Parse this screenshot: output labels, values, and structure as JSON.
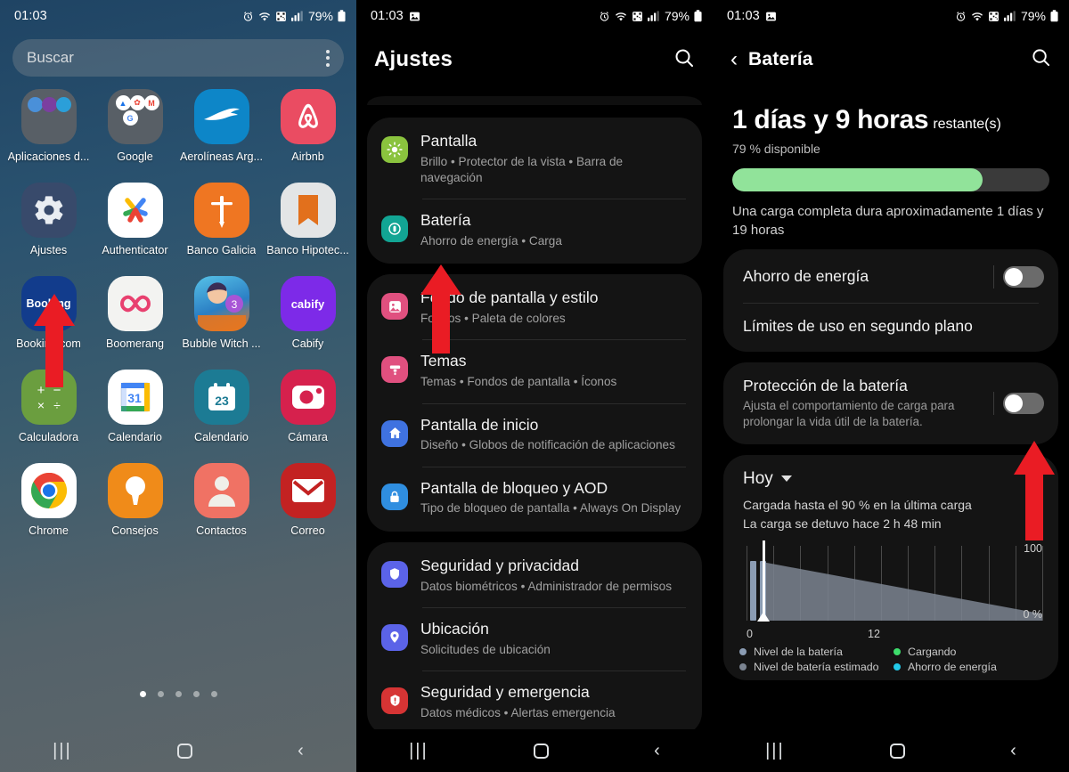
{
  "status_bar": {
    "time": "01:03",
    "battery_pct": "79%",
    "icons": [
      "alarm-icon",
      "wifi-icon",
      "nfc-icon",
      "signal-icon",
      "battery-icon"
    ],
    "icons_left_dark": [
      "screenshot-icon"
    ]
  },
  "home": {
    "search": {
      "placeholder": "Buscar",
      "menu": "more-options"
    },
    "apps": [
      {
        "label": "Aplicaciones d...",
        "type": "folder"
      },
      {
        "label": "Google",
        "type": "folder"
      },
      {
        "label": "Aerolíneas Arg...",
        "type": "app"
      },
      {
        "label": "Airbnb",
        "type": "app"
      },
      {
        "label": "Ajustes",
        "type": "app"
      },
      {
        "label": "Authenticator",
        "type": "app"
      },
      {
        "label": "Banco Galicia",
        "type": "app"
      },
      {
        "label": "Banco Hipotec...",
        "type": "app"
      },
      {
        "label": "Booking.com",
        "type": "app"
      },
      {
        "label": "Boomerang",
        "type": "app"
      },
      {
        "label": "Bubble Witch ...",
        "type": "app"
      },
      {
        "label": "Cabify",
        "type": "app"
      },
      {
        "label": "Calculadora",
        "type": "app"
      },
      {
        "label": "Calendario",
        "type": "app"
      },
      {
        "label": "Calendario",
        "type": "app"
      },
      {
        "label": "Cámara",
        "type": "app"
      },
      {
        "label": "Chrome",
        "type": "app"
      },
      {
        "label": "Consejos",
        "type": "app"
      },
      {
        "label": "Contactos",
        "type": "app"
      },
      {
        "label": "Correo",
        "type": "app"
      }
    ],
    "page_dots": 5,
    "active_dot": 1
  },
  "settings": {
    "title": "Ajustes",
    "search_icon": "search-icon",
    "groups": [
      {
        "items": [
          {
            "title": "Pantalla",
            "subtitle": "Brillo  •  Protector de la vista  •  Barra de navegación",
            "icon": "display-icon",
            "color": "#8ac33e"
          },
          {
            "title": "Batería",
            "subtitle": "Ahorro de energía  •  Carga",
            "icon": "battery-icon",
            "color": "#12a594"
          }
        ]
      },
      {
        "items": [
          {
            "title": "Fondo de pantalla y estilo",
            "subtitle": "Fondos  •  Paleta de colores",
            "icon": "wallpaper-icon",
            "color": "#e0507f"
          },
          {
            "title": "Temas",
            "subtitle": "Temas  •  Fondos de pantalla  •  Íconos",
            "icon": "themes-icon",
            "color": "#e0507f"
          },
          {
            "title": "Pantalla de inicio",
            "subtitle": "Diseño  •  Globos de notificación de aplicaciones",
            "icon": "home-icon",
            "color": "#3f72e0"
          },
          {
            "title": "Pantalla de bloqueo y AOD",
            "subtitle": "Tipo de bloqueo de pantalla  •  Always On Display",
            "icon": "lock-icon",
            "color": "#2f8ee0"
          }
        ]
      },
      {
        "items": [
          {
            "title": "Seguridad y privacidad",
            "subtitle": "Datos biométricos  •  Administrador de permisos",
            "icon": "shield-icon",
            "color": "#5b63e8"
          },
          {
            "title": "Ubicación",
            "subtitle": "Solicitudes de ubicación",
            "icon": "location-pin-icon",
            "color": "#5b63e8"
          },
          {
            "title": "Seguridad y emergencia",
            "subtitle": "Datos médicos  •  Alertas emergencia",
            "icon": "emergency-icon",
            "color": "#d63434"
          }
        ]
      }
    ]
  },
  "battery": {
    "title": "Batería",
    "back_icon": "back-arrow-icon",
    "search_icon": "search-icon",
    "remaining_headline": "1 días y 9 horas",
    "remaining_suffix": "restante(s)",
    "available": "79 % disponible",
    "level_pct": 79,
    "bar_color": "#91e39a",
    "full_charge_note": "Una carga completa dura aproximadamente 1 días y 19 horas",
    "power_saving_label": "Ahorro de energía",
    "power_saving_on": false,
    "background_limits_label": "Límites de uso en segundo plano",
    "protection_title": "Protección de la batería",
    "protection_subtitle": "Ajusta el comportamiento de carga para prolongar la vida útil de la batería.",
    "protection_on": false,
    "period_label": "Hoy",
    "charge_line_1": "Cargada hasta el 90 % en la última carga",
    "charge_line_2": "La carga se detuvo hace 2 h 48 min",
    "legend": [
      {
        "label": "Nivel de la batería",
        "color": "#8b9cb3"
      },
      {
        "label": "Cargando",
        "color": "#3ddc6b"
      },
      {
        "label": "Nivel de batería estimado",
        "color": "#7b8491"
      },
      {
        "label": "Ahorro de energía",
        "color": "#22c9e8"
      }
    ]
  },
  "chart_data": {
    "type": "area",
    "title": "",
    "xlabel": "",
    "ylabel": "",
    "xticks": [
      "0",
      "12"
    ],
    "xtick_positions": [
      0,
      50
    ],
    "yticks": [
      "100",
      "0 %"
    ],
    "ylim": [
      0,
      100
    ],
    "xlim": [
      0,
      24
    ],
    "grid": true,
    "series": [
      {
        "name": "Nivel de la batería",
        "color": "#8b9cb3",
        "x": [
          0.3,
          1.1
        ],
        "values": [
          79,
          79
        ]
      },
      {
        "name": "Nivel de batería estimado",
        "color": "#7b8491",
        "x": [
          1.1,
          24
        ],
        "values": [
          79,
          9
        ]
      }
    ],
    "now_marker_x": 1.3
  },
  "nav_bar": {
    "recent": "recents-button",
    "home": "home-button",
    "back": "back-button"
  },
  "annotations": {
    "arrow_color": "#ea1c24",
    "arrows": [
      {
        "name": "arrow-pointing-to-ajustes",
        "panel": 1
      },
      {
        "name": "arrow-pointing-to-bateria",
        "panel": 2
      },
      {
        "name": "arrow-pointing-to-battery-protection-toggle",
        "panel": 3
      }
    ]
  }
}
